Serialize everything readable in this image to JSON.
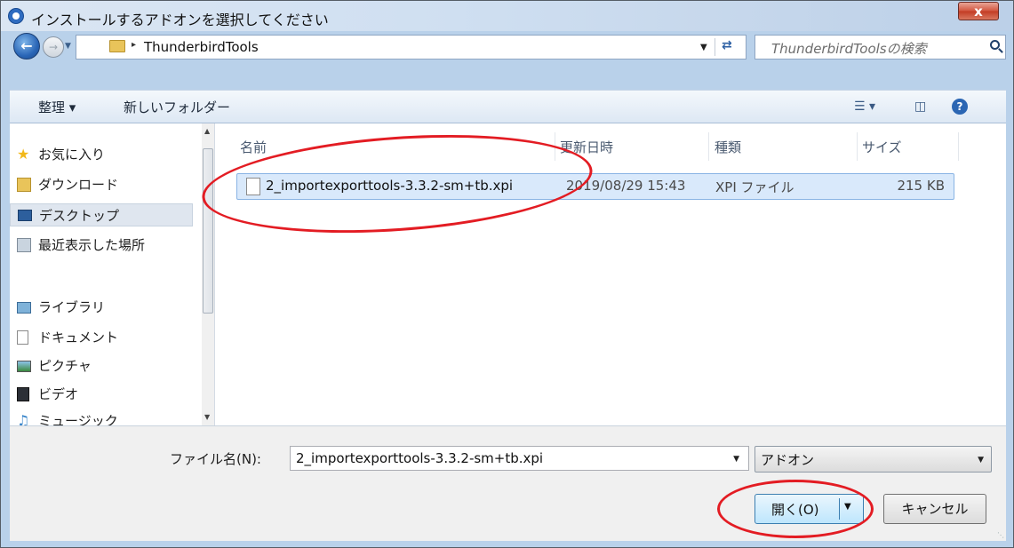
{
  "window": {
    "title": "インストールするアドオンを選択してください",
    "close_label": "x"
  },
  "address_bar": {
    "path_separator": "▸",
    "current_folder": "ThunderbirdTools",
    "search_placeholder": "ThunderbirdToolsの検索"
  },
  "toolbar": {
    "organize_label": "整理 ▾",
    "new_folder_label": "新しいフォルダー"
  },
  "sidebar": {
    "favorites_label": "お気に入り",
    "items": [
      {
        "label": "ダウンロード",
        "icon": "download-folder-icon"
      },
      {
        "label": "デスクトップ",
        "icon": "desktop-icon",
        "selected": true
      },
      {
        "label": "最近表示した場所",
        "icon": "recent-places-icon"
      }
    ],
    "libraries_label": "ライブラリ",
    "library_items": [
      {
        "label": "ドキュメント",
        "icon": "documents-icon"
      },
      {
        "label": "ピクチャ",
        "icon": "pictures-icon"
      },
      {
        "label": "ビデオ",
        "icon": "videos-icon"
      },
      {
        "label": "ミュージック",
        "icon": "music-icon"
      }
    ]
  },
  "file_list": {
    "columns": [
      "名前",
      "更新日時",
      "種類",
      "サイズ"
    ],
    "rows": [
      {
        "name": "2_importexporttools-3.3.2-sm+tb.xpi",
        "modified": "2019/08/29 15:43",
        "type": "XPI ファイル",
        "size": "215 KB"
      }
    ]
  },
  "footer": {
    "filename_label": "ファイル名(N):",
    "filename_value": "2_importexporttools-3.3.2-sm+tb.xpi",
    "filetype_value": "アドオン",
    "open_label": "開く(O)",
    "cancel_label": "キャンセル"
  },
  "colors": {
    "annotation": "#e31c23",
    "selection": "#d9e9fb"
  }
}
